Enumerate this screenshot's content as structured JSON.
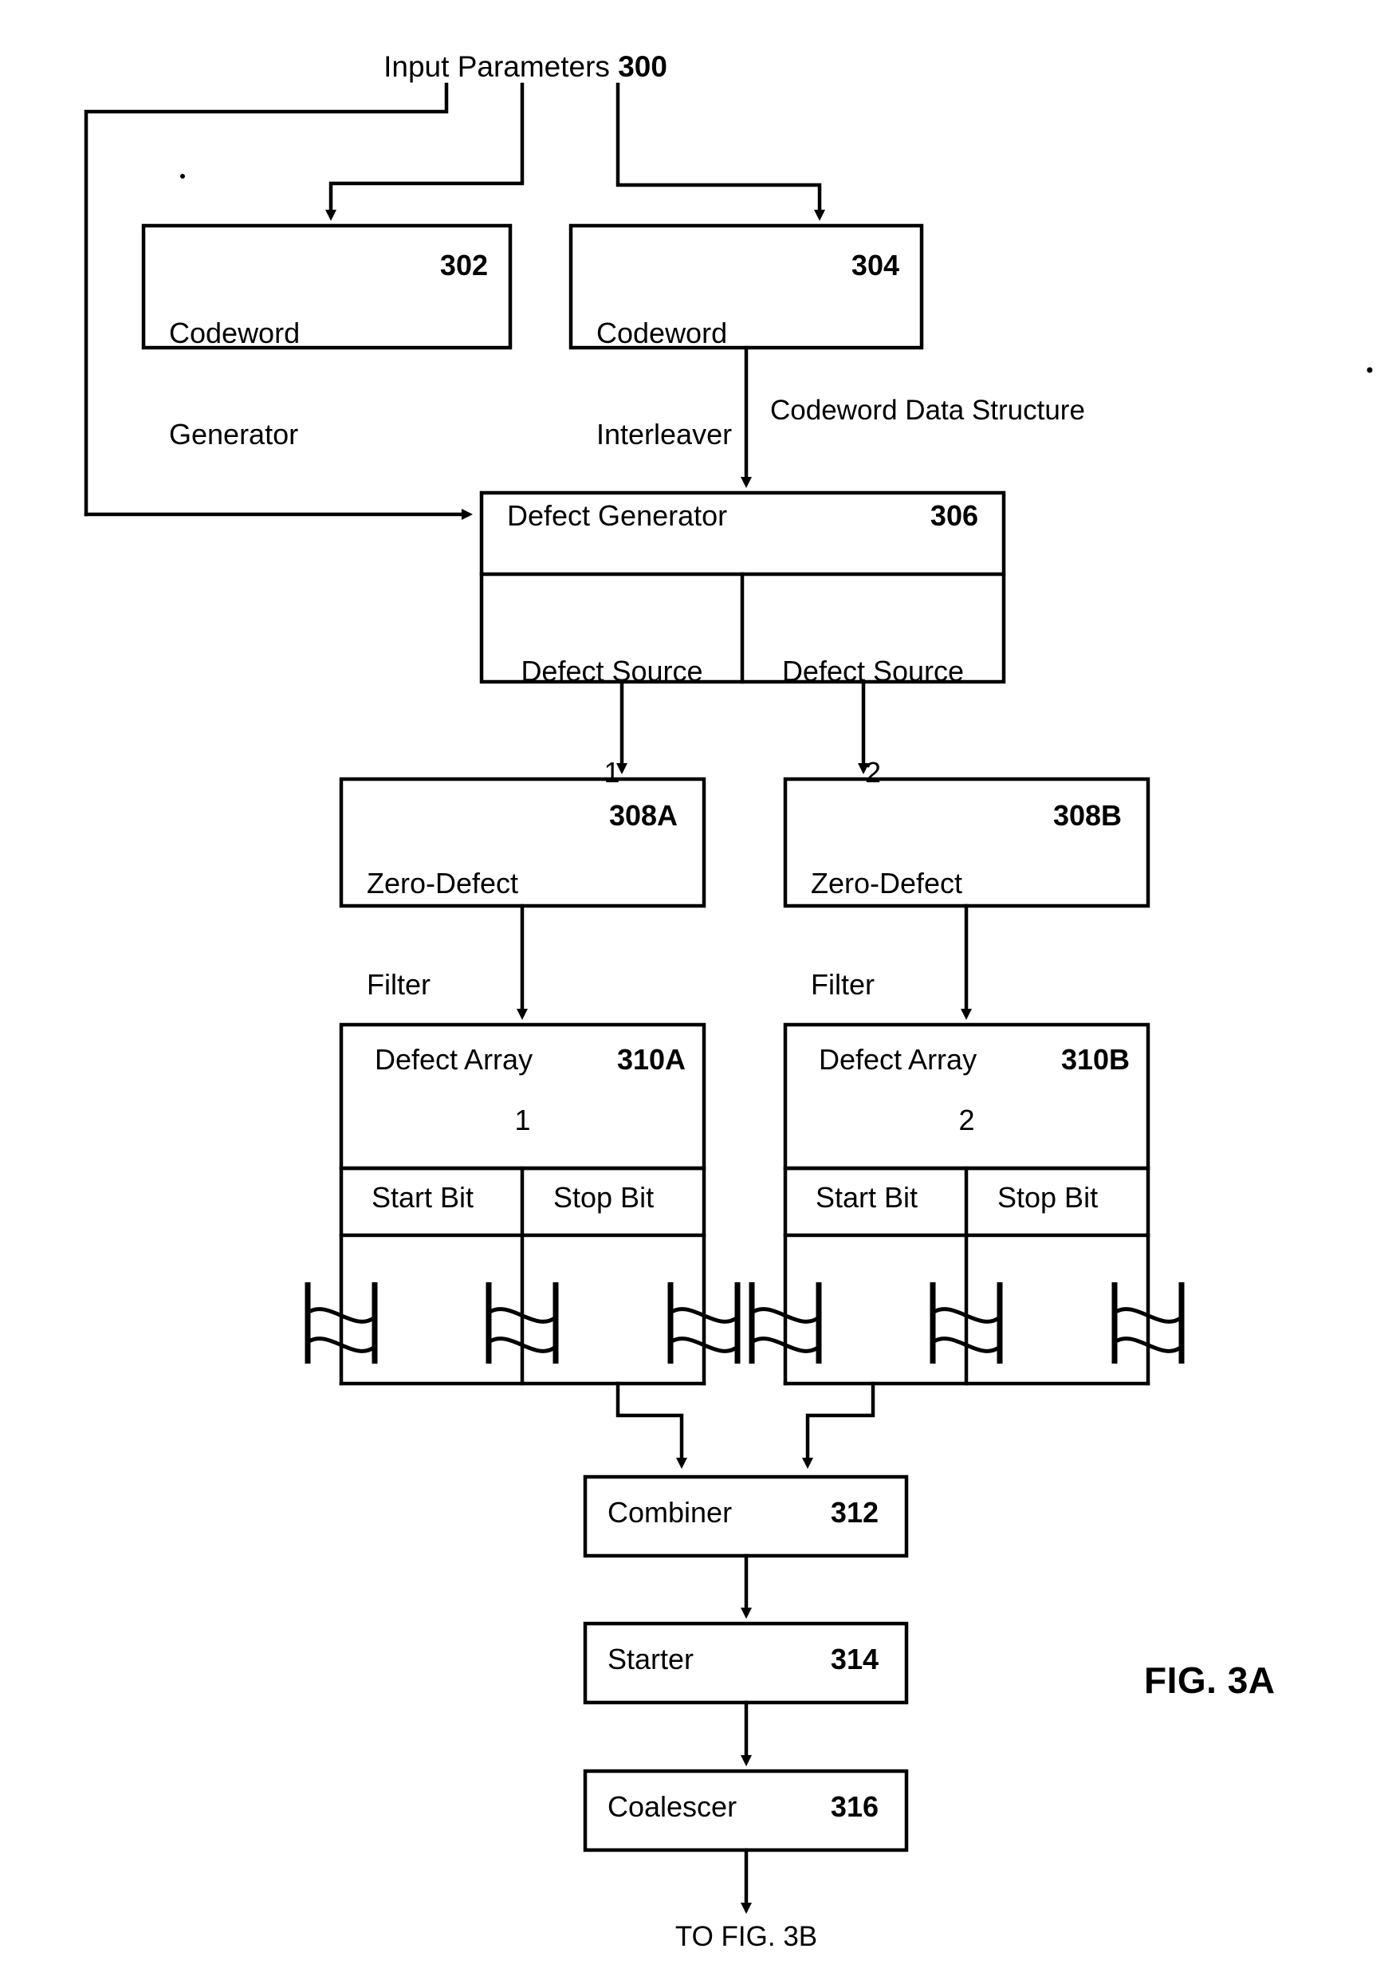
{
  "figure": {
    "caption": "FIG. 3A",
    "input_label_text": "Input Parameters",
    "input_label_ref": "300",
    "edge_label_codeword_data_structure": "Codeword Data Structure",
    "to_fig_label": "TO FIG. 3B"
  },
  "blocks": {
    "codeword_generator": {
      "line1": "Codeword",
      "line2": "Generator",
      "ref": "302"
    },
    "codeword_interleaver": {
      "line1": "Codeword",
      "line2": "Interleaver",
      "ref": "304"
    },
    "defect_generator": {
      "title": "Defect Generator",
      "ref": "306",
      "sources": [
        {
          "line1": "Defect Source",
          "line2": "1"
        },
        {
          "line1": "Defect Source",
          "line2": "2"
        }
      ]
    },
    "zero_defect_filter_a": {
      "line1": "Zero-Defect",
      "line2": "Filter",
      "ref": "308A"
    },
    "zero_defect_filter_b": {
      "line1": "Zero-Defect",
      "line2": "Filter",
      "ref": "308B"
    },
    "defect_array_a": {
      "title": "Defect Array",
      "ref": "310A",
      "index": "1",
      "columns": [
        "Start Bit",
        "Stop Bit"
      ]
    },
    "defect_array_b": {
      "title": "Defect Array",
      "ref": "310B",
      "index": "2",
      "columns": [
        "Start Bit",
        "Stop Bit"
      ]
    },
    "combiner": {
      "title": "Combiner",
      "ref": "312"
    },
    "starter": {
      "title": "Starter",
      "ref": "314"
    },
    "coalescer": {
      "title": "Coalescer",
      "ref": "316"
    }
  },
  "colors": {
    "ink": "#000000",
    "paper": "#ffffff"
  }
}
